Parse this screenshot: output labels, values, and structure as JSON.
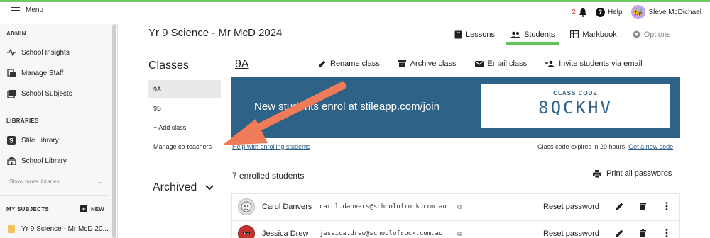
{
  "topbar": {
    "menu_label": "Menu",
    "notification_count": "2",
    "help_label": "Help",
    "user_name": "Sleve McDichael"
  },
  "sidebar": {
    "admin_heading": "ADMIN",
    "admin_items": [
      "School Insights",
      "Manage Staff",
      "School Subjects"
    ],
    "libraries_heading": "LIBRARIES",
    "library_items": [
      "Stile Library",
      "School Library"
    ],
    "show_more": "Show more libraries",
    "subjects_heading": "MY SUBJECTS",
    "new_label": "NEW",
    "subject_items": [
      "Yr 9 Science - Mr McD 20..."
    ]
  },
  "header": {
    "title": "Yr 9 Science - Mr McD 2024",
    "tabs": [
      "Lessons",
      "Students",
      "Markbook",
      "Options"
    ]
  },
  "classes": {
    "heading": "Classes",
    "items": [
      "9A",
      "9B"
    ],
    "add_class": "+ Add class",
    "manage_coteachers": "Manage co-teachers",
    "archived": "Archived"
  },
  "class_panel": {
    "name": "9A",
    "actions": [
      "Rename class",
      "Archive class",
      "Email class",
      "Invite students via email"
    ],
    "banner_text": "New students enrol at stileapp.com/join",
    "code_label": "CLASS CODE",
    "code_value": "8QCKHV",
    "help_link": "Help with enrolling students",
    "expires_text": "Class code expires in 20 hours.",
    "new_code_link": "Get a new code",
    "enrolled_text": "7 enrolled students",
    "print_label": "Print all passwords"
  },
  "students": [
    {
      "name": "Carol Danvers",
      "email": "carol.danvers@schoolofrock.com.au",
      "reset": "Reset password"
    },
    {
      "name": "Jessica Drew",
      "email": "jessica.drew@schoolofrock.com.au",
      "reset": "Reset password"
    }
  ],
  "colors": {
    "accent_green": "#6ecb63",
    "banner_blue": "#2f6287",
    "arrow_orange": "#ef7b58",
    "notification_red": "#d0342c"
  }
}
